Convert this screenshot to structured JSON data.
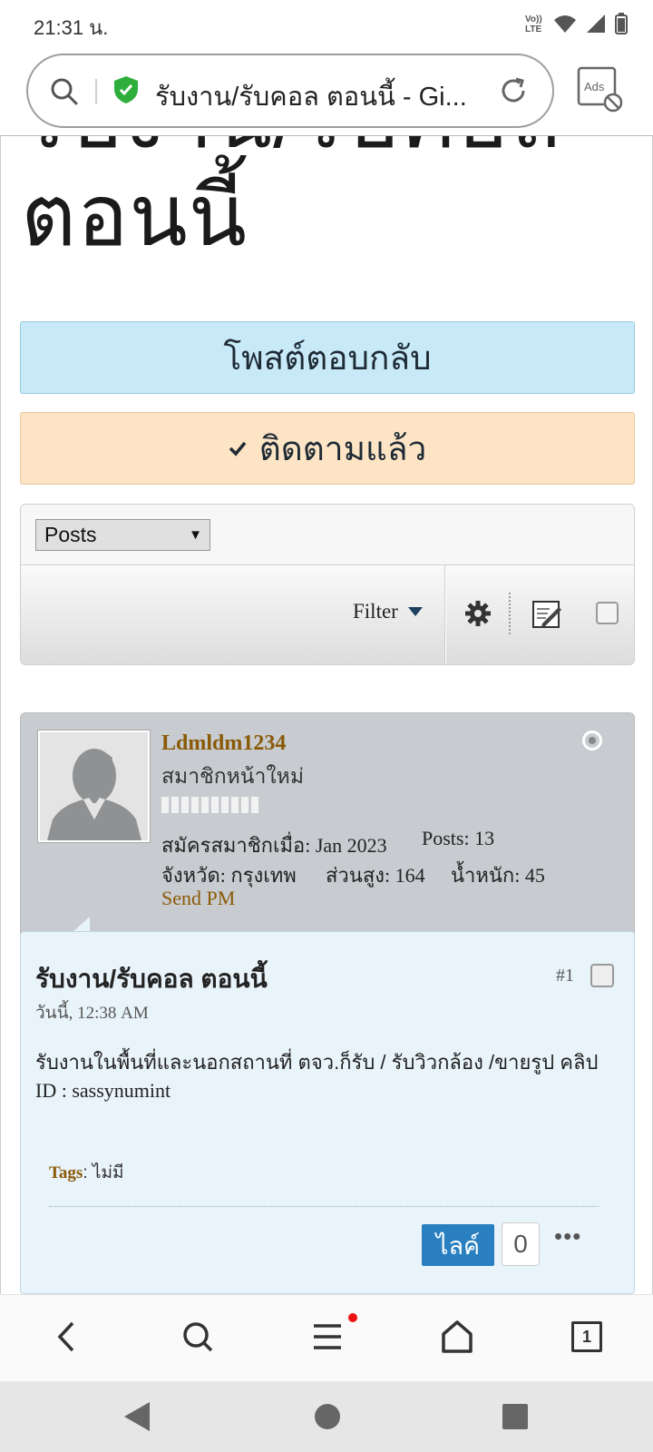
{
  "status_bar": {
    "time": "21:31 น.",
    "volte_label": "Vo)) LTE"
  },
  "address_bar": {
    "url_title": "รับงาน/รับคอล ตอนนี้ - Gi...",
    "ads_label": "Ads"
  },
  "page": {
    "title_line1": "รับงาน/รับคอล",
    "title_line2": "ตอนนี้",
    "reply_button": "โพสต์ตอบกลับ",
    "follow_button": "ติดตามแล้ว",
    "posts_select": "Posts",
    "filter_label": "Filter"
  },
  "post": {
    "username": "Ldmldm1234",
    "user_title": "สมาชิกหน้าใหม่",
    "joined": "สมัครสมาชิกเมื่อ: Jan 2023",
    "posts_count": "Posts: 13",
    "province": "จังหวัด: กรุงเทพ",
    "height": "ส่วนสูง: 164",
    "weight": "น้ำหนัก: 45",
    "send_pm": "Send PM",
    "title": "รับงาน/รับคอล ตอนนี้",
    "date": "วันนี้, 12:38 AM",
    "post_number": "#1",
    "body_line1": "รับงานในพื้นที่และนอกสถานที่ ตจว.ก็รับ / รับวิวกล้อง /ขายรูป คลิป",
    "body_line2": "ID : sassynumint",
    "tags_label": "Tags",
    "tags_value": "ไม่มี",
    "like_label": "ไลค์",
    "like_count": "0",
    "more_label": "•••"
  },
  "browser_nav": {
    "tab_count": "1"
  },
  "colors": {
    "reply_bg": "#c8e9f7",
    "follow_bg": "#fde4c4",
    "username": "#8a5a07",
    "like_button": "#2a7fc1",
    "post_body_bg": "#e8f3fa",
    "post_head_bg": "#c8cbcf"
  }
}
